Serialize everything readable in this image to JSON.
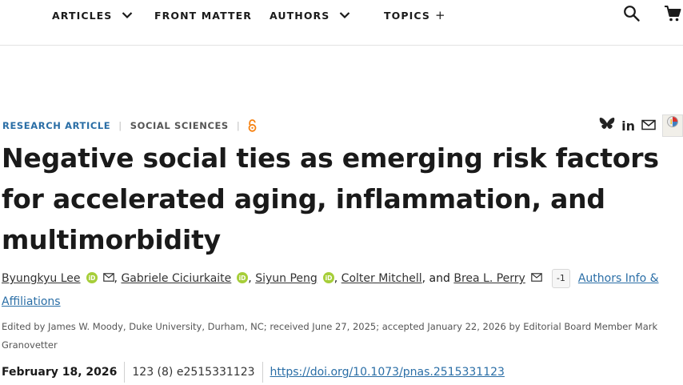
{
  "nav": {
    "articles": "ARTICLES",
    "front_matter": "FRONT MATTER",
    "authors": "AUTHORS",
    "topics": "TOPICS",
    "topics_plus": "+"
  },
  "article": {
    "type": "RESEARCH ARTICLE",
    "separator": "|",
    "subject": "SOCIAL SCIENCES",
    "title": "Negative social ties as emerging risk factors for accelerated aging, inflammation, and multimorbidity",
    "authors": [
      {
        "name": "Byungkyu Lee"
      },
      {
        "name": "Gabriele Ciciurkaite"
      },
      {
        "name": "Siyun Peng"
      },
      {
        "name": "Colter Mitchell"
      },
      {
        "name": "Brea L. Perry"
      }
    ],
    "comma": ",",
    "and": "and",
    "collapse_label": "-1",
    "affiliations_label": "Authors Info & Affiliations",
    "edited_by": "Edited by James W. Moody, Duke University, Durham, NC; received June 27, 2025; accepted January 22, 2026 by Editorial Board Member Mark Granovetter",
    "date": "February 18, 2026",
    "citation": "123 (8) e2515331123",
    "doi": "https://doi.org/10.1073/pnas.2515331123",
    "linkedin_label": "in"
  },
  "colors": {
    "link": "#2a6ea6",
    "orcid": "#a6ce39",
    "open_access": "#f68212"
  },
  "icons": [
    "chevron-down-icon",
    "search-icon",
    "cart-icon",
    "open-access-icon",
    "bluesky-icon",
    "linkedin-icon",
    "mail-icon",
    "crossmark-icon",
    "orcid-icon"
  ]
}
